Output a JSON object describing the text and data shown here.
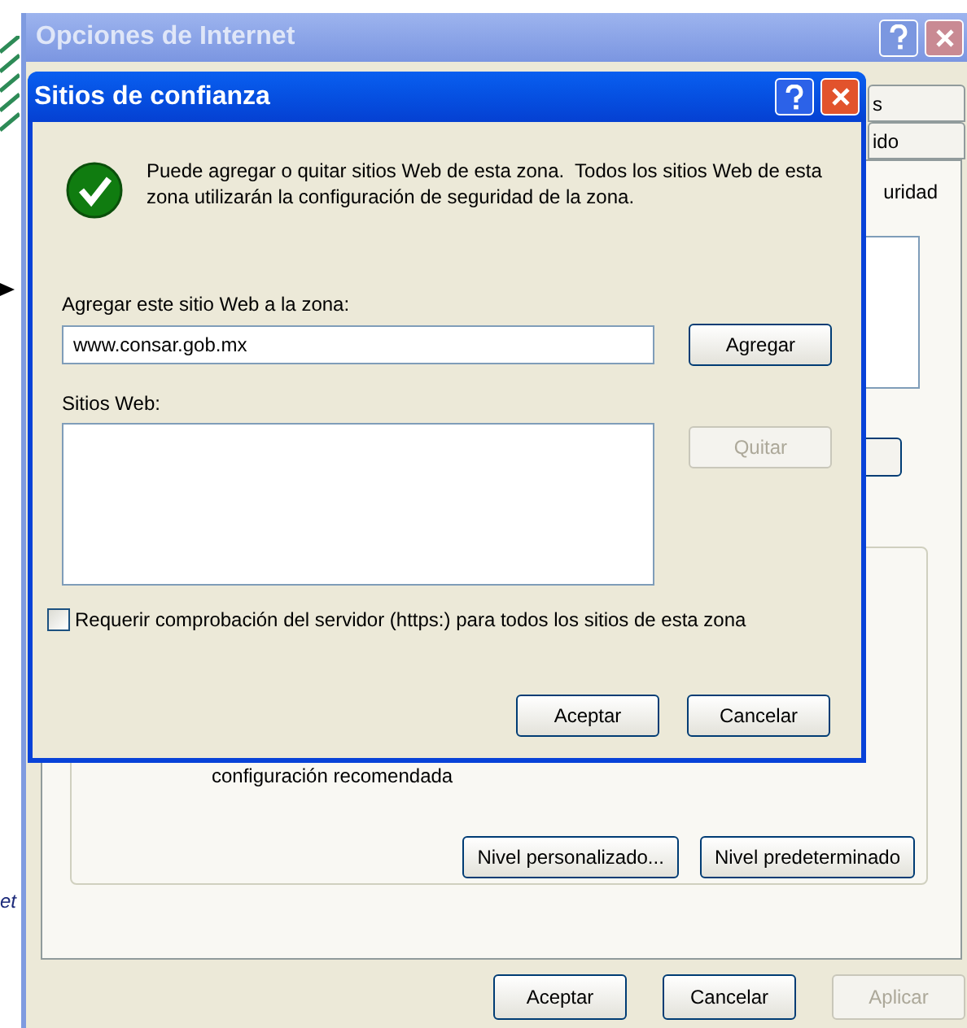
{
  "desktop": {
    "text": "et"
  },
  "back_window": {
    "title": "Opciones de Internet",
    "tabs": [
      {
        "label": "s",
        "selected": false
      },
      {
        "label": "ido",
        "selected": false
      }
    ],
    "panel_text": "uridad",
    "group_text": "configuración recomendada",
    "group_buttons": [
      {
        "label": "Nivel personalizado...",
        "disabled": false
      },
      {
        "label": "Nivel predeterminado",
        "disabled": false
      }
    ],
    "buttons": [
      {
        "label": "Aceptar",
        "disabled": false
      },
      {
        "label": "Cancelar",
        "disabled": false
      },
      {
        "label": "Aplicar",
        "disabled": true
      }
    ]
  },
  "dialog": {
    "title": "Sitios de confianza",
    "message": "Puede agregar o quitar sitios Web de esta zona.  Todos los sitios Web de esta zona utilizarán la configuración de seguridad de la zona.",
    "add_label": "Agregar este sitio Web a la zona:",
    "add_field": {
      "value": "www.consar.gob.mx"
    },
    "add_button": {
      "label": "Agregar",
      "disabled": false
    },
    "sites_label": "Sitios Web:",
    "remove_button": {
      "label": "Quitar",
      "disabled": true
    },
    "require_https": {
      "label": "Requerir comprobación del servidor (https:) para todos los sitios de esta zona",
      "checked": false
    },
    "buttons": [
      {
        "label": "Aceptar",
        "disabled": false
      },
      {
        "label": "Cancelar",
        "disabled": false
      }
    ]
  }
}
